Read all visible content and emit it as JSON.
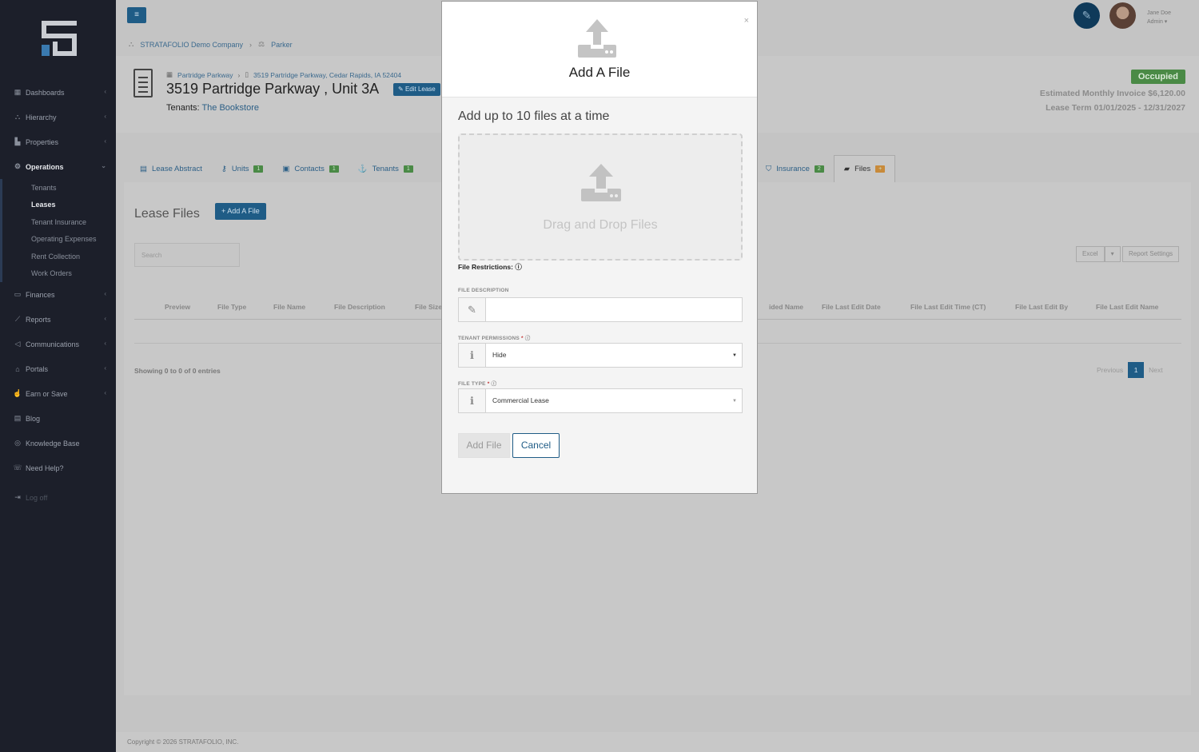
{
  "sidebar": {
    "items": [
      {
        "label": "Dashboards",
        "icon": "grid-icon",
        "chevron": true
      },
      {
        "label": "Hierarchy",
        "icon": "hierarchy-icon",
        "chevron": true
      },
      {
        "label": "Properties",
        "icon": "bar-chart-icon",
        "chevron": true
      },
      {
        "label": "Operations",
        "icon": "gears-icon",
        "chevron": true,
        "active": true
      }
    ],
    "operations_sub": [
      "Tenants",
      "Leases",
      "Tenant Insurance",
      "Operating Expenses",
      "Rent Collection",
      "Work Orders"
    ],
    "operations_selected": "Leases",
    "items_after": [
      {
        "label": "Finances",
        "icon": "money-icon",
        "chevron": true
      },
      {
        "label": "Reports",
        "icon": "line-chart-icon",
        "chevron": true
      },
      {
        "label": "Communications",
        "icon": "megaphone-icon",
        "chevron": true
      },
      {
        "label": "Portals",
        "icon": "bank-icon",
        "chevron": true
      },
      {
        "label": "Earn or Save",
        "icon": "thumbs-up-icon",
        "chevron": true
      },
      {
        "label": "Blog",
        "icon": "newspaper-icon",
        "chevron": false
      },
      {
        "label": "Knowledge Base",
        "icon": "life-ring-icon",
        "chevron": false
      },
      {
        "label": "Need Help?",
        "icon": "chat-icon",
        "chevron": false
      }
    ],
    "logoff": "Log off"
  },
  "topbar": {
    "company": "STRATAFOLIO Demo Company",
    "portfolio": "Parker",
    "user_name": "Jane Doe",
    "user_role": "Admin"
  },
  "header": {
    "crumb1": "Partridge Parkway",
    "crumb2": "3519 Partridge Parkway, Cedar Rapids, IA 52404",
    "title": "3519 Partridge Parkway , Unit 3A",
    "edit_lease": "Edit Lease",
    "tenants_label": "Tenants:",
    "tenant_name": "The Bookstore",
    "status": "Occupied",
    "invoice": "Estimated Monthly Invoice $6,120.00",
    "term": "Lease Term 01/01/2025 - 12/31/2027"
  },
  "tabs": [
    {
      "label": "Lease Abstract",
      "icon": "document-icon",
      "badge": ""
    },
    {
      "label": "Units",
      "icon": "key-icon",
      "badge": "1"
    },
    {
      "label": "Contacts",
      "icon": "contact-card-icon",
      "badge": "1"
    },
    {
      "label": "Tenants",
      "icon": "user-icon",
      "badge": "1"
    }
  ],
  "tabs_right": [
    {
      "label": "Insurance",
      "icon": "shield-icon",
      "badge": "2"
    },
    {
      "label": "Files",
      "icon": "folder-icon",
      "badge": "+",
      "active": true
    }
  ],
  "files": {
    "title": "Lease Files",
    "add_button": "Add A File",
    "search_placeholder": "Search",
    "excel": "Excel",
    "report_settings": "Report Settings",
    "columns_left": [
      "Preview",
      "File Type",
      "File Name",
      "File Description",
      "File Size"
    ],
    "columns_right": [
      "ided Name",
      "File Last Edit Date",
      "File Last Edit Time (CT)",
      "File Last Edit By",
      "File Last Edit Name"
    ],
    "showing": "Showing 0 to 0 of 0 entries",
    "previous": "Previous",
    "page": "1",
    "next": "Next"
  },
  "footer": "Copyright © 2026 STRATAFOLIO, INC.",
  "modal": {
    "title": "Add A File",
    "close": "×",
    "subtitle": "Add up to 10 files at a time",
    "dropzone_text": "Drag and Drop Files",
    "restrictions": "File Restrictions:",
    "desc_label": "FILE DESCRIPTION",
    "desc_value": "",
    "perm_label": "TENANT PERMISSIONS",
    "perm_value": "Hide",
    "type_label": "FILE TYPE",
    "type_value": "Commercial Lease",
    "add_button": "Add File",
    "cancel_button": "Cancel"
  }
}
